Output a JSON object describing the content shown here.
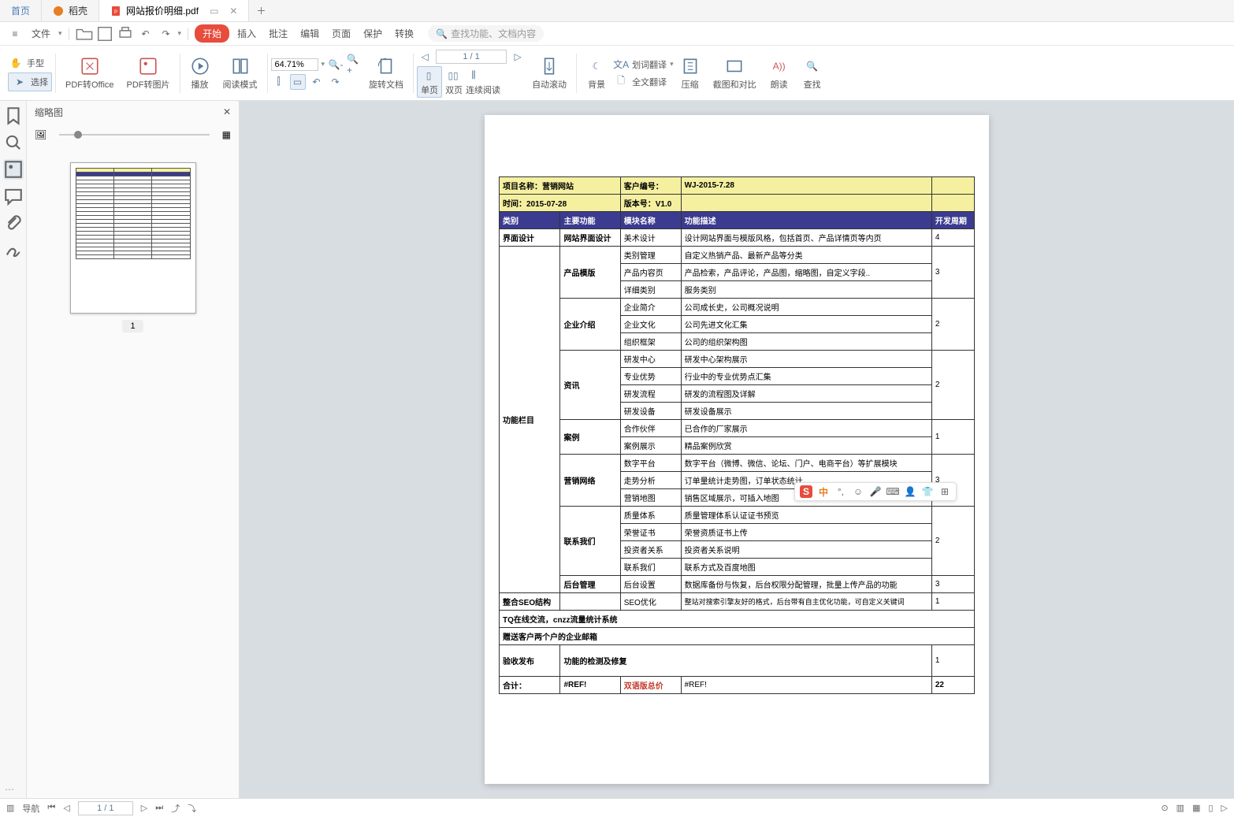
{
  "tabs": {
    "home": "首页",
    "doke": "稻壳",
    "active": "网站报价明细.pdf"
  },
  "menu": {
    "file": "文件",
    "start": "开始",
    "insert": "插入",
    "annotate": "批注",
    "edit": "编辑",
    "page": "页面",
    "protect": "保护",
    "convert": "转换",
    "search_placeholder": "查找功能、文档内容"
  },
  "toolbar": {
    "hand": "手型",
    "select": "选择",
    "pdf_to_office": "PDF转Office",
    "pdf_to_image": "PDF转图片",
    "play": "播放",
    "read_mode": "阅读模式",
    "zoom": "64.71%",
    "rotate": "旋转文档",
    "page_indicator": "1 / 1",
    "single_page": "单页",
    "double_page": "双页",
    "continuous": "连续阅读",
    "auto_scroll": "自动滚动",
    "background": "背景",
    "word_translate": "划词翻译",
    "full_translate": "全文翻译",
    "compress": "压缩",
    "screenshot_compare": "截图和对比",
    "read_aloud": "朗读",
    "find": "查找"
  },
  "thumb": {
    "title": "缩略图",
    "page_num": "1"
  },
  "pdf": {
    "h1_project_label": "项目名称：",
    "h1_project_value": "营销网站",
    "h1_client_label": "客户编号：",
    "h1_client_value": "WJ-2015-7.28",
    "h2_time_label": "时间：",
    "h2_time_value": "2015-07-28",
    "h2_version_label": "版本号：",
    "h2_version_value": "V1.0",
    "cols": {
      "c1": "类别",
      "c2": "主要功能",
      "c3": "模块名称",
      "c4": "功能描述",
      "c5": "开发周期"
    },
    "r_ui": {
      "cat": "界面设计",
      "main": "网站界面设计",
      "mod": "美术设计",
      "desc": "设计网站界面与模版风格，包括首页、产品详情页等内页",
      "dev": "4"
    },
    "func_cat": "功能栏目",
    "product": {
      "main": "产品模版",
      "m1": "类别管理",
      "d1": "自定义热销产品、最新产品等分类",
      "m2": "产品内容页",
      "d2": "产品检索，产品评论，产品图，缩略图，自定义字段..",
      "m3": "详细类别",
      "d3": "服务类别",
      "dev": "3"
    },
    "company": {
      "main": "企业介绍",
      "m1": "企业简介",
      "d1": "公司成长史，公司概况说明",
      "m2": "企业文化",
      "d2": "公司先进文化汇集",
      "m3": "组织框架",
      "d3": "公司的组织架构图",
      "dev": "2"
    },
    "news": {
      "main": "资讯",
      "m1": "研发中心",
      "d1": "研发中心架构展示",
      "m2": "专业优势",
      "d2": "行业中的专业优势点汇集",
      "m3": "研发流程",
      "d3": "研发的流程图及详解",
      "m4": "研发设备",
      "d4": "研发设备展示",
      "dev": "2"
    },
    "case": {
      "main": "案例",
      "m1": "合作伙伴",
      "d1": "已合作的厂家展示",
      "m2": "案例展示",
      "d2": "精品案例欣赏",
      "dev": "1"
    },
    "network": {
      "main": "营销网络",
      "m1": "数字平台",
      "d1": "数字平台（微博、微信、论坛、门户、电商平台）等扩展模块",
      "m2": "走势分析",
      "d2": "订单量统计走势图，订单状态统计",
      "m3": "营销地图",
      "d3": "销售区域展示，可插入地图",
      "dev": "3"
    },
    "contact": {
      "main": "联系我们",
      "m1": "质量体系",
      "d1": "质量管理体系认证证书预览",
      "m2": "荣誉证书",
      "d2": "荣誉资质证书上传",
      "m3": "投资者关系",
      "d3": "投资者关系说明",
      "m4": "联系我们",
      "d4": "联系方式及百度地图",
      "dev": "2"
    },
    "backend": {
      "cat": "后台管理",
      "mod": "后台设置",
      "desc": "数据库备份与恢复，后台权限分配管理，批量上传产品的功能",
      "dev": "3"
    },
    "seo": {
      "cat": "整合SEO结构",
      "mod": "SEO优化",
      "desc": "整站对搜索引擎友好的格式，后台带有自主优化功能，可自定义关键词",
      "dev": "1"
    },
    "bonus1": "TQ在线交流，cnzz流量统计系统",
    "bonus2": "赠送客户两个户的企业邮箱",
    "accept": {
      "cat": "验收发布",
      "desc": "功能的检测及修复",
      "dev": "1"
    },
    "total": {
      "cat": "合计：",
      "ref1": "#REF!",
      "bilingual": "双语版总价",
      "ref2": "#REF!",
      "dev": "22"
    }
  },
  "ime": {
    "zhong": "中"
  },
  "status": {
    "nav": "导航",
    "page": "1 / 1"
  }
}
